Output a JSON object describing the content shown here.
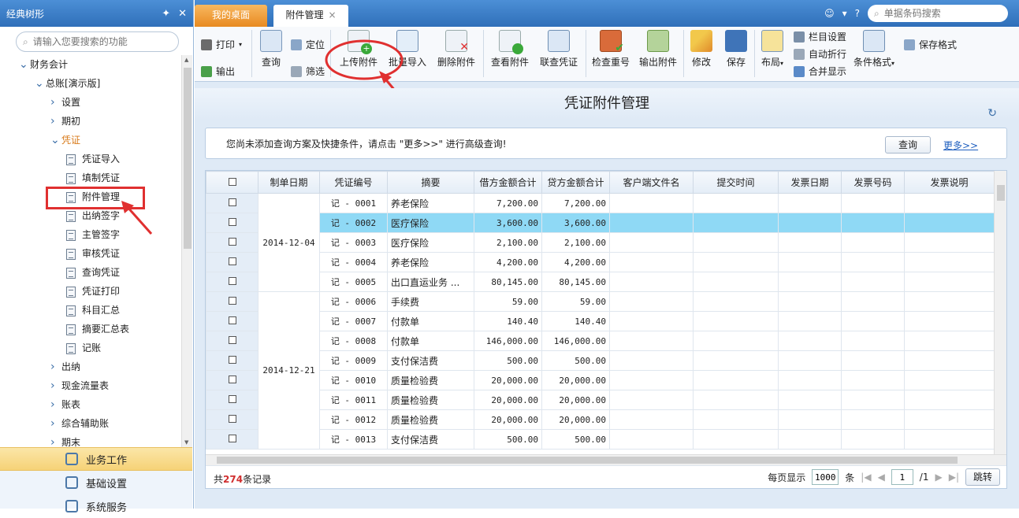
{
  "left": {
    "header_title": "经典树形",
    "search_placeholder": "请输入您要搜索的功能",
    "tree": [
      {
        "label": "财务会计",
        "level": 0,
        "arrow": "down"
      },
      {
        "label": "总账[演示版]",
        "level": 1,
        "arrow": "down"
      },
      {
        "label": "设置",
        "level": 2,
        "arrow": "right"
      },
      {
        "label": "期初",
        "level": 2,
        "arrow": "right"
      },
      {
        "label": "凭证",
        "level": 2,
        "arrow": "down",
        "orange": true
      },
      {
        "label": "凭证导入",
        "level": 3,
        "doc": true
      },
      {
        "label": "填制凭证",
        "level": 3,
        "doc": true
      },
      {
        "label": "附件管理",
        "level": 3,
        "doc": true,
        "selected": true
      },
      {
        "label": "出纳签字",
        "level": 3,
        "doc": true
      },
      {
        "label": "主管签字",
        "level": 3,
        "doc": true
      },
      {
        "label": "审核凭证",
        "level": 3,
        "doc": true
      },
      {
        "label": "查询凭证",
        "level": 3,
        "doc": true
      },
      {
        "label": "凭证打印",
        "level": 3,
        "doc": true
      },
      {
        "label": "科目汇总",
        "level": 3,
        "doc": true
      },
      {
        "label": "摘要汇总表",
        "level": 3,
        "doc": true
      },
      {
        "label": "记账",
        "level": 3,
        "doc": true
      },
      {
        "label": "出纳",
        "level": 2,
        "arrow": "right"
      },
      {
        "label": "现金流量表",
        "level": 2,
        "arrow": "right"
      },
      {
        "label": "账表",
        "level": 2,
        "arrow": "right"
      },
      {
        "label": "综合辅助账",
        "level": 2,
        "arrow": "right"
      },
      {
        "label": "期末",
        "level": 2,
        "arrow": "right"
      }
    ],
    "bottom": [
      {
        "label": "业务工作",
        "active": true
      },
      {
        "label": "基础设置",
        "active": false
      },
      {
        "label": "系统服务",
        "active": false
      }
    ]
  },
  "tabs": [
    {
      "label": "我的桌面"
    },
    {
      "label": "附件管理",
      "close": "×"
    }
  ],
  "top_search_placeholder": "单据条码搜索",
  "toolbar": {
    "print": "打印",
    "export": "输出",
    "query": "查询",
    "locate": "定位",
    "filter": "筛选",
    "upload": "上传附件",
    "batch_import": "批量导入",
    "delete_attach": "删除附件",
    "view_attach": "查看附件",
    "link_voucher": "联查凭证",
    "check_dup": "检查重号",
    "export_attach": "输出附件",
    "modify": "修改",
    "save": "保存",
    "layout": "布局",
    "col_settings": "栏目设置",
    "auto_wrap": "自动折行",
    "merge_display": "合并显示",
    "cond_format": "条件格式",
    "save_format": "保存格式"
  },
  "page_title": "凭证附件管理",
  "query_panel": {
    "hint": "您尚未添加查询方案及快捷条件，请点击 \"更多>>\" 进行高级查询!",
    "query_button": "查询",
    "more_link": "更多>>"
  },
  "grid": {
    "columns": [
      "制单日期",
      "凭证编号",
      "摘要",
      "借方金额合计",
      "贷方金额合计",
      "客户端文件名",
      "提交时间",
      "发票日期",
      "发票号码",
      "发票说明"
    ],
    "date_groups": [
      {
        "date": "2014-12-04",
        "rows": 5
      },
      {
        "date": "2014-12-21",
        "rows": 8
      }
    ],
    "rows": [
      {
        "code": "记 - 0001",
        "summary": "养老保险",
        "debit": "7,200.00",
        "credit": "7,200.00"
      },
      {
        "code": "记 - 0002",
        "summary": "医疗保险",
        "debit": "3,600.00",
        "credit": "3,600.00",
        "selected": true
      },
      {
        "code": "记 - 0003",
        "summary": "医疗保险",
        "debit": "2,100.00",
        "credit": "2,100.00"
      },
      {
        "code": "记 - 0004",
        "summary": "养老保险",
        "debit": "4,200.00",
        "credit": "4,200.00"
      },
      {
        "code": "记 - 0005",
        "summary": "出口直运业务 ...",
        "debit": "80,145.00",
        "credit": "80,145.00"
      },
      {
        "code": "记 - 0006",
        "summary": "手续费",
        "debit": "59.00",
        "credit": "59.00"
      },
      {
        "code": "记 - 0007",
        "summary": "付款单",
        "debit": "140.40",
        "credit": "140.40"
      },
      {
        "code": "记 - 0008",
        "summary": "付款单",
        "debit": "146,000.00",
        "credit": "146,000.00"
      },
      {
        "code": "记 - 0009",
        "summary": "支付保洁费",
        "debit": "500.00",
        "credit": "500.00"
      },
      {
        "code": "记 - 0010",
        "summary": "质量检验费",
        "debit": "20,000.00",
        "credit": "20,000.00"
      },
      {
        "code": "记 - 0011",
        "summary": "质量检验费",
        "debit": "20,000.00",
        "credit": "20,000.00"
      },
      {
        "code": "记 - 0012",
        "summary": "质量检验费",
        "debit": "20,000.00",
        "credit": "20,000.00"
      },
      {
        "code": "记 - 0013",
        "summary": "支付保洁费",
        "debit": "500.00",
        "credit": "500.00"
      }
    ]
  },
  "footer": {
    "total_prefix": "共",
    "total_count": "274",
    "total_suffix": "条记录",
    "per_page_label": "每页显示",
    "per_page": "1000",
    "per_page_unit": "条",
    "current_page": "1",
    "total_pages": "/1",
    "jump": "跳转"
  }
}
